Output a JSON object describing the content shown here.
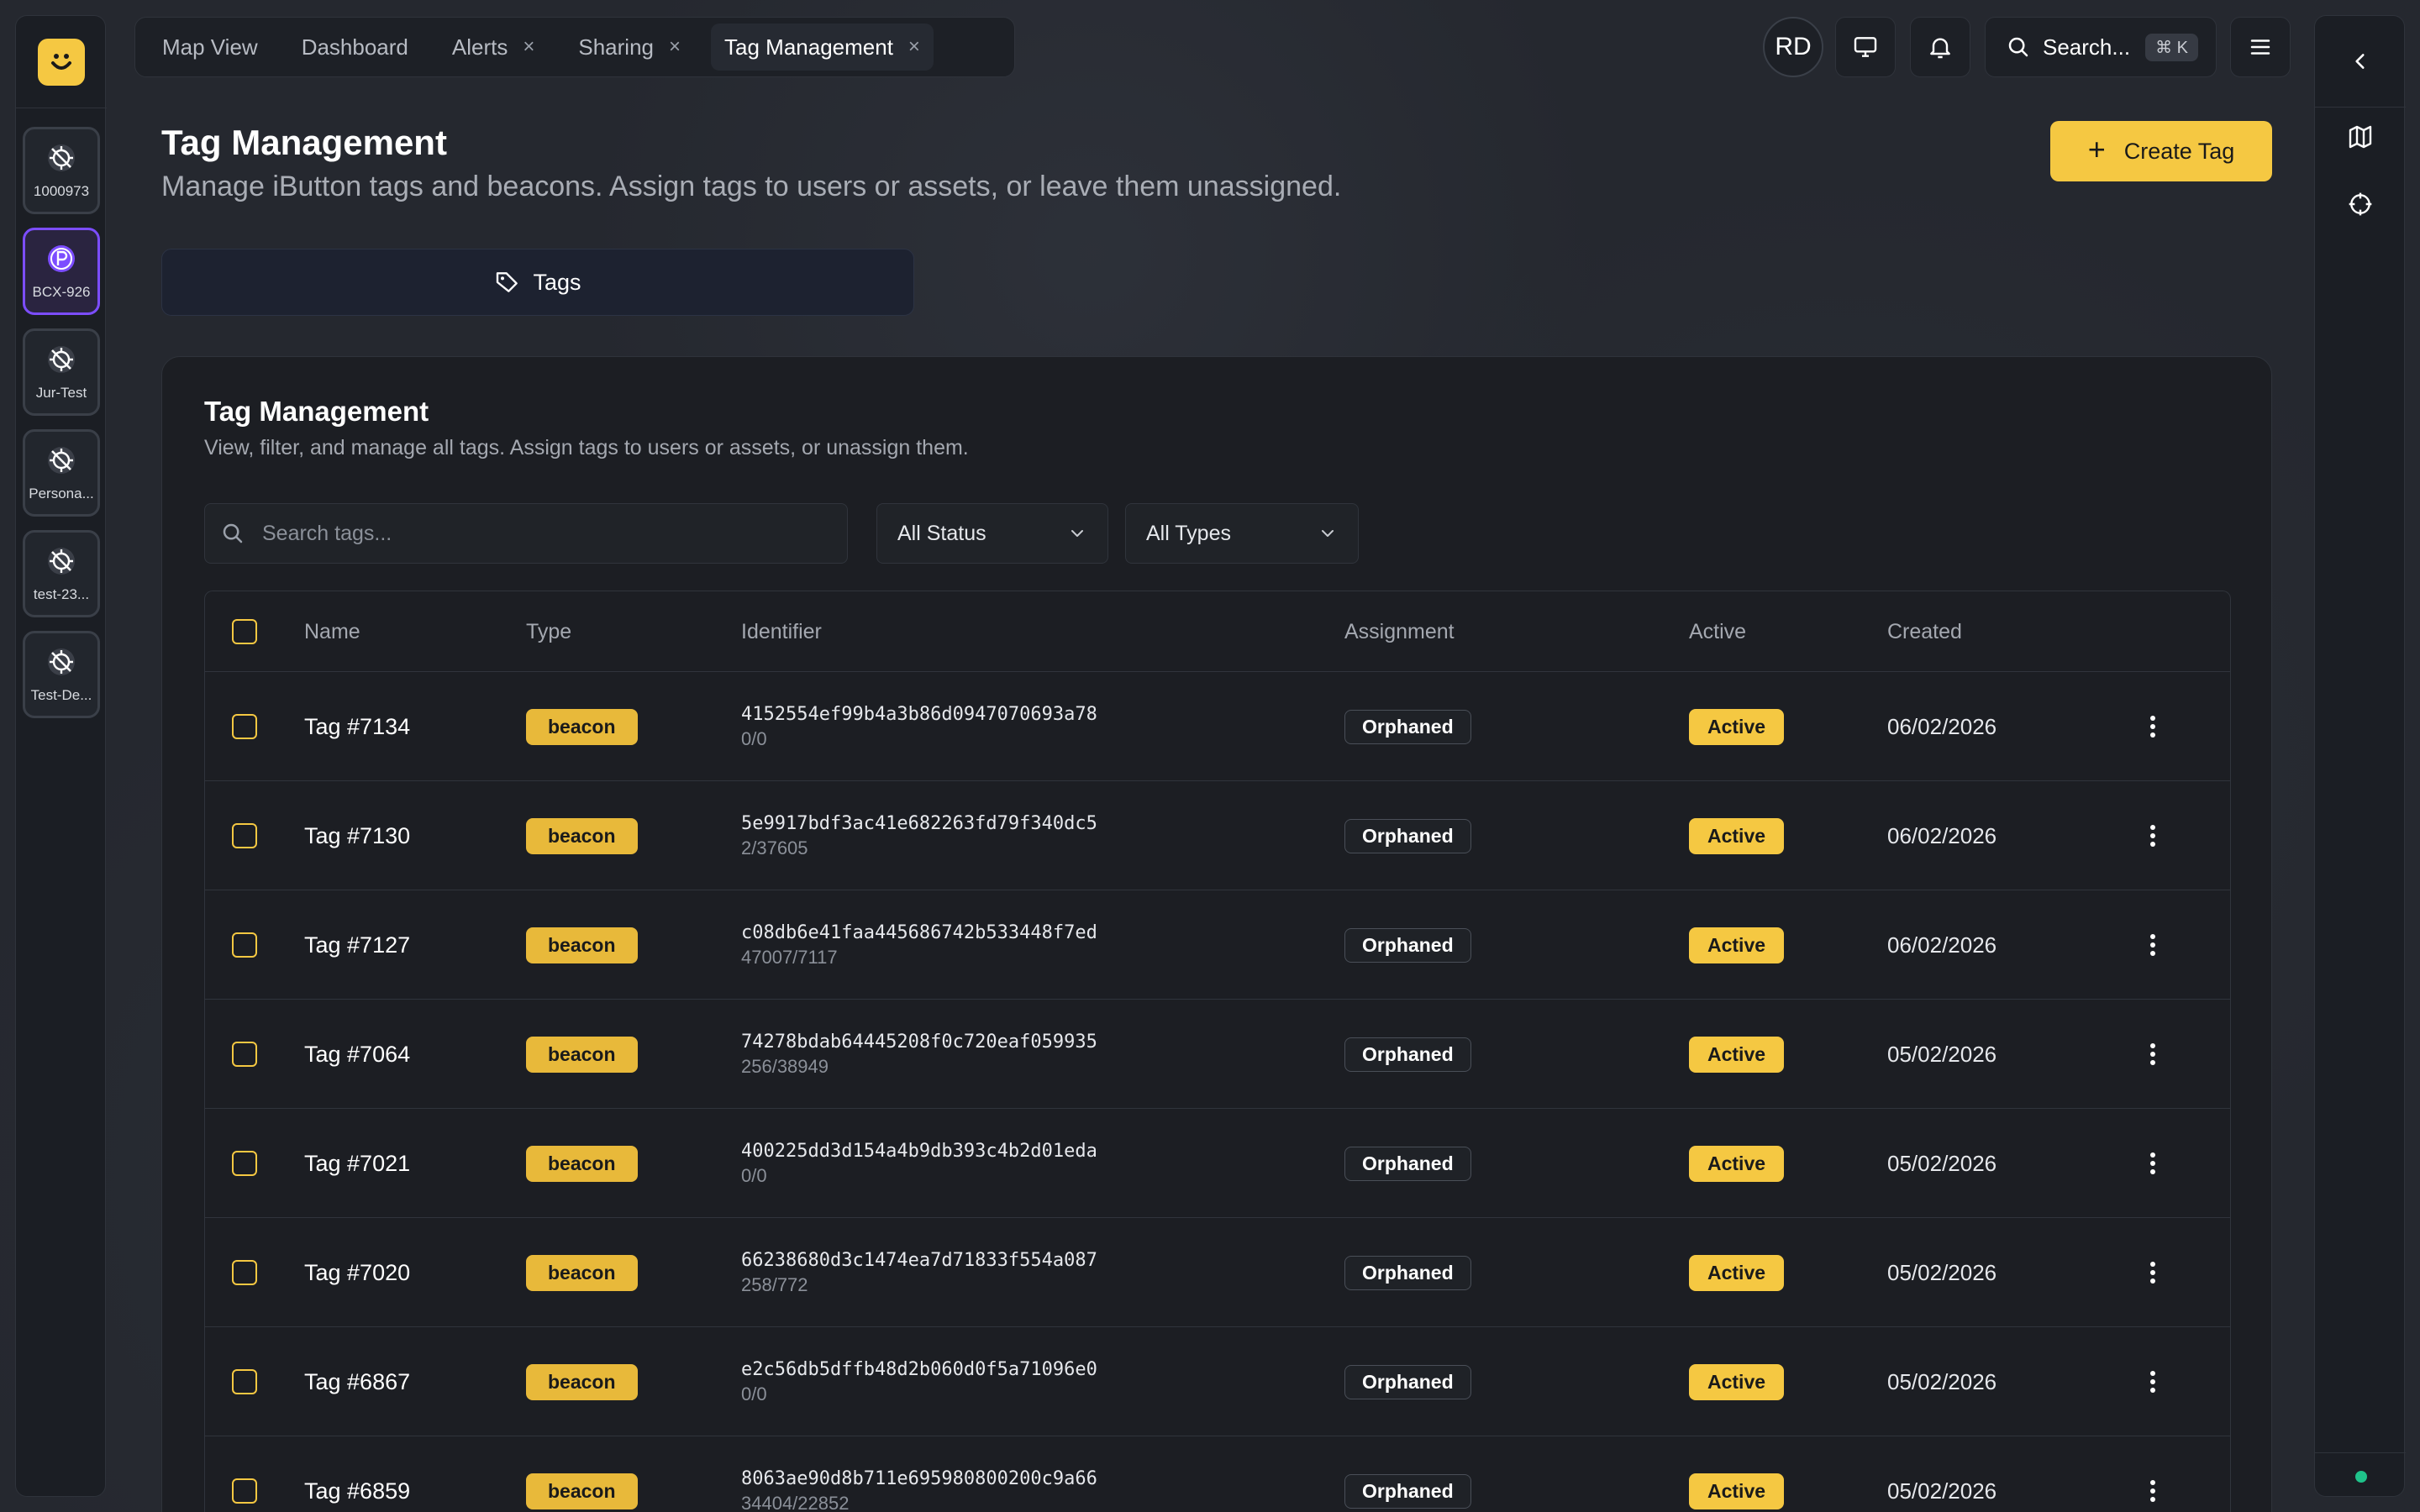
{
  "tabs": [
    {
      "label": "Map View",
      "closable": false,
      "active": false
    },
    {
      "label": "Dashboard",
      "closable": false,
      "active": false
    },
    {
      "label": "Alerts",
      "closable": true,
      "active": false
    },
    {
      "label": "Sharing",
      "closable": true,
      "active": false
    },
    {
      "label": "Tag Management",
      "closable": true,
      "active": true
    }
  ],
  "tab_close_glyph": "×",
  "header": {
    "avatar_initials": "RD",
    "search_label": "Search...",
    "search_shortcut": "⌘ K"
  },
  "devices": [
    {
      "label": "1000973",
      "icon": "location-off-icon",
      "selected": false
    },
    {
      "label": "BCX-926",
      "icon": "parking-icon",
      "selected": true
    },
    {
      "label": "Jur-Test",
      "icon": "location-off-icon",
      "selected": false
    },
    {
      "label": "Persona...",
      "icon": "location-off-icon",
      "selected": false
    },
    {
      "label": "test-23...",
      "icon": "location-off-icon",
      "selected": false
    },
    {
      "label": "Test-De...",
      "icon": "location-off-icon",
      "selected": false
    }
  ],
  "page": {
    "title": "Tag Management",
    "subtitle": "Manage iButton tags and beacons. Assign tags to users or assets, or leave them unassigned.",
    "create_button": "Create Tag",
    "section_tab": "Tags"
  },
  "card": {
    "title": "Tag Management",
    "subtitle": "View, filter, and manage all tags. Assign tags to users or assets, or unassign them.",
    "search_placeholder": "Search tags...",
    "status_filter": "All Status",
    "type_filter": "All Types"
  },
  "table": {
    "columns": {
      "name": "Name",
      "type": "Type",
      "identifier": "Identifier",
      "assignment": "Assignment",
      "active": "Active",
      "created": "Created"
    },
    "rows": [
      {
        "name": "Tag #7134",
        "type": "beacon",
        "identifier": "4152554ef99b4a3b86d0947070693a78",
        "sub": "0/0",
        "assignment": "Orphaned",
        "active": "Active",
        "created": "06/02/2026"
      },
      {
        "name": "Tag #7130",
        "type": "beacon",
        "identifier": "5e9917bdf3ac41e682263fd79f340dc5",
        "sub": "2/37605",
        "assignment": "Orphaned",
        "active": "Active",
        "created": "06/02/2026"
      },
      {
        "name": "Tag #7127",
        "type": "beacon",
        "identifier": "c08db6e41faa445686742b533448f7ed",
        "sub": "47007/7117",
        "assignment": "Orphaned",
        "active": "Active",
        "created": "06/02/2026"
      },
      {
        "name": "Tag #7064",
        "type": "beacon",
        "identifier": "74278bdab64445208f0c720eaf059935",
        "sub": "256/38949",
        "assignment": "Orphaned",
        "active": "Active",
        "created": "05/02/2026"
      },
      {
        "name": "Tag #7021",
        "type": "beacon",
        "identifier": "400225dd3d154a4b9db393c4b2d01eda",
        "sub": "0/0",
        "assignment": "Orphaned",
        "active": "Active",
        "created": "05/02/2026"
      },
      {
        "name": "Tag #7020",
        "type": "beacon",
        "identifier": "66238680d3c1474ea7d71833f554a087",
        "sub": "258/772",
        "assignment": "Orphaned",
        "active": "Active",
        "created": "05/02/2026"
      },
      {
        "name": "Tag #6867",
        "type": "beacon",
        "identifier": "e2c56db5dffb48d2b060d0f5a71096e0",
        "sub": "0/0",
        "assignment": "Orphaned",
        "active": "Active",
        "created": "05/02/2026"
      },
      {
        "name": "Tag #6859",
        "type": "beacon",
        "identifier": "8063ae90d8b711e695980800200c9a66",
        "sub": "34404/22852",
        "assignment": "Orphaned",
        "active": "Active",
        "created": "05/02/2026"
      }
    ]
  },
  "colors": {
    "accent": "#f5c842",
    "selected_device": "#7c4dff",
    "online_status": "#1fc28a"
  }
}
